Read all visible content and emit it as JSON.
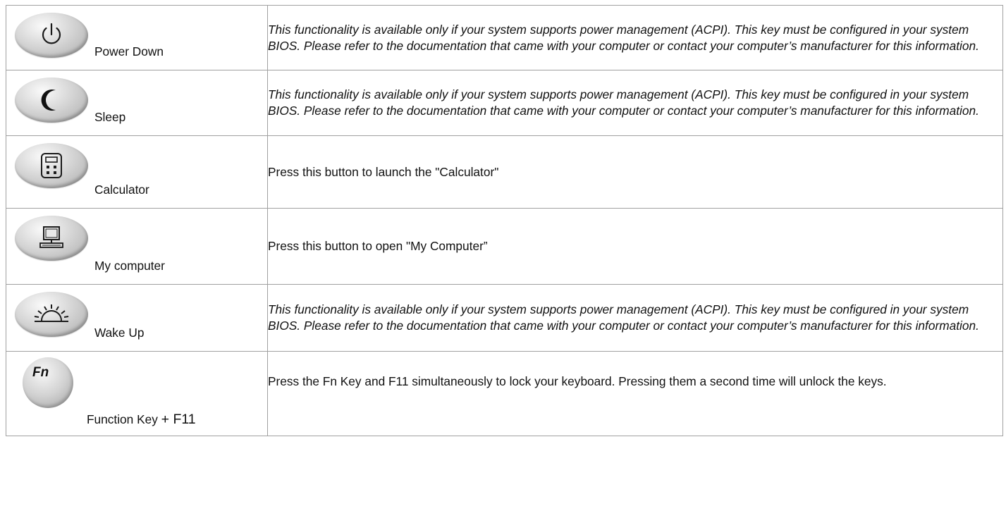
{
  "rows": [
    {
      "icon": "power-icon",
      "label": "Power Down",
      "description": "This functionality is available only if your system supports power management (ACPI). This key must be configured in your system BIOS. Please refer to the documentation that came with your computer or contact your computer’s manufacturer for this information."
    },
    {
      "icon": "moon-icon",
      "label": "Sleep",
      "description": "This functionality is available only if your system supports power management (ACPI). This key must be configured in your system BIOS. Please refer to the documentation that came with your computer or contact your computer’s manufacturer for this information."
    },
    {
      "icon": "calculator-icon",
      "label": "Calculator",
      "description": "Press this button to launch the \"Calculator\""
    },
    {
      "icon": "computer-icon",
      "label": "My computer",
      "description": "Press this button to open \"My Computer”"
    },
    {
      "icon": "sunrise-icon",
      "label": "Wake Up",
      "description": "This functionality is available only if your system supports power management (ACPI). This key must be configured in your system BIOS. Please refer to the documentation that came with your computer or contact your computer’s manufacturer for this information."
    },
    {
      "icon": "fn-key-icon",
      "key_text": "Fn",
      "label_main": "Function Key ",
      "label_combo": "+ F11",
      "description": "Press the Fn Key and F11 simultaneously to lock your keyboard. Pressing them a second time will unlock the keys."
    }
  ]
}
